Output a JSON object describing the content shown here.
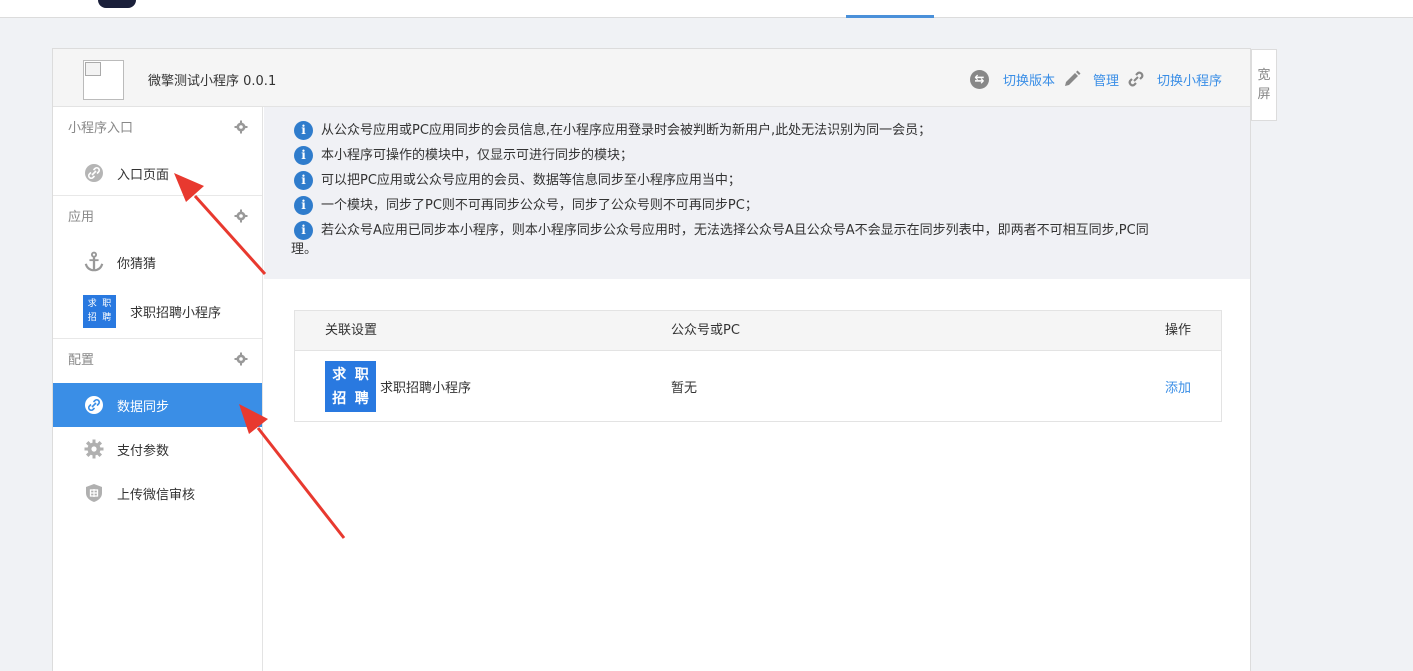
{
  "header": {
    "app_name": "微擎测试小程序 0.0.1",
    "actions": [
      {
        "label": "切换版本",
        "icon": "switch-version-icon"
      },
      {
        "label": "管理",
        "icon": "pencil-icon"
      },
      {
        "label": "切换小程序",
        "icon": "link-icon"
      }
    ],
    "wide_screen_label": "宽屏"
  },
  "sidebar": {
    "groups": [
      {
        "title": "小程序入口",
        "items": [
          {
            "label": "入口页面",
            "icon": "link-icon"
          }
        ]
      },
      {
        "title": "应用",
        "items": [
          {
            "label": "你猜猜",
            "icon": "anchor-icon"
          },
          {
            "label": "求职招聘小程序",
            "icon": "app-logo-icon",
            "logo_chars": [
              "求",
              "职",
              "招",
              "聘"
            ]
          }
        ]
      },
      {
        "title": "配置",
        "items": [
          {
            "label": "数据同步",
            "icon": "link-icon",
            "active": true
          },
          {
            "label": "支付参数",
            "icon": "gear-icon"
          },
          {
            "label": "上传微信审核",
            "icon": "shield-icon"
          }
        ]
      }
    ]
  },
  "notices": [
    "从公众号应用或PC应用同步的会员信息,在小程序应用登录时会被判断为新用户,此处无法识别为同一会员；",
    "本小程序可操作的模块中，仅显示可进行同步的模块；",
    "可以把PC应用或公众号应用的会员、数据等信息同步至小程序应用当中；",
    "一个模块，同步了PC则不可再同步公众号，同步了公众号则不可再同步PC；",
    "若公众号A应用已同步本小程序，则本小程序同步公众号应用时，无法选择公众号A且公众号A不会显示在同步列表中，即两者不可相互同步,PC同",
    "理。"
  ],
  "table": {
    "headers": [
      "关联设置",
      "公众号或PC",
      "操作"
    ],
    "rows": [
      {
        "logo_chars": [
          "求",
          "职",
          "招",
          "聘"
        ],
        "name": "求职招聘小程序",
        "target": "暂无",
        "action": "添加"
      }
    ]
  },
  "colors": {
    "accent": "#3a8ee6",
    "logo_blue": "#2979e0",
    "arrow_red": "#e8392f"
  }
}
